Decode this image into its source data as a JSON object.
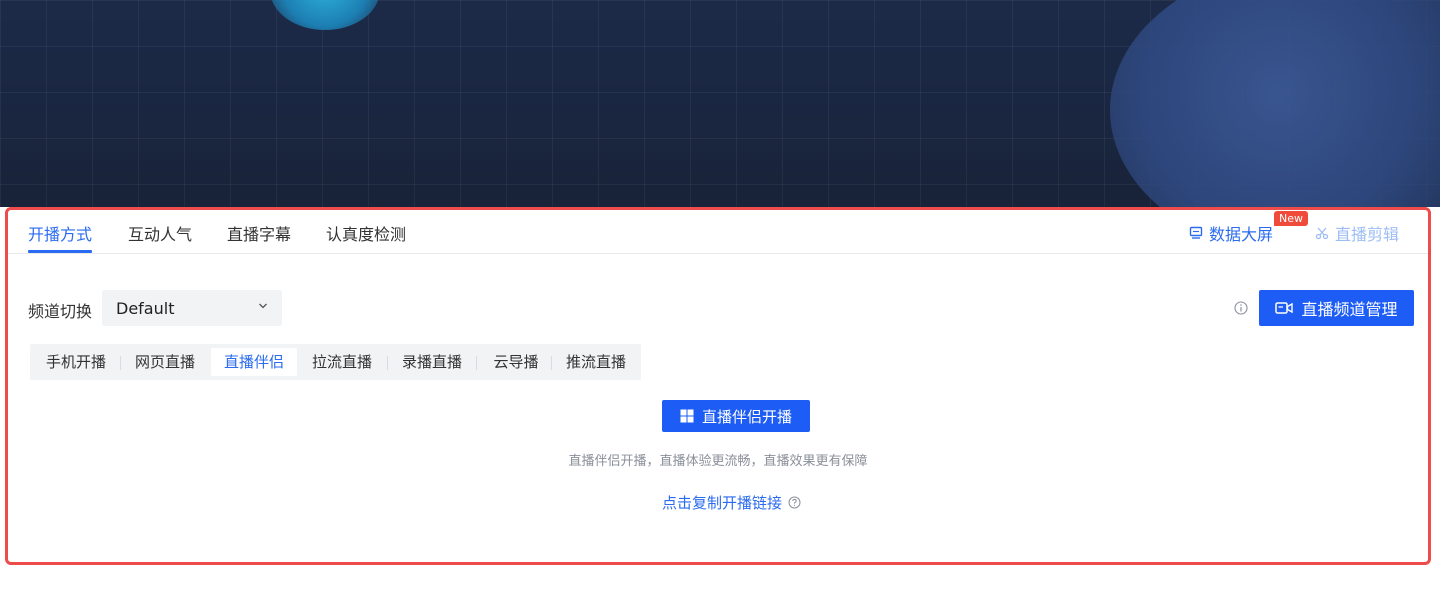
{
  "tabs": [
    {
      "label": "开播方式",
      "active": true
    },
    {
      "label": "互动人气",
      "active": false
    },
    {
      "label": "直播字幕",
      "active": false
    },
    {
      "label": "认真度检测",
      "active": false
    }
  ],
  "top_right": {
    "data_screen": {
      "label": "数据大屏",
      "icon": "monitor-icon",
      "badge": "New"
    },
    "live_edit": {
      "label": "直播剪辑",
      "icon": "scissors-icon",
      "disabled": true
    }
  },
  "channel": {
    "label": "频道切换",
    "selected": "Default"
  },
  "manage_button": {
    "label": "直播频道管理",
    "icon": "camera-icon"
  },
  "modes": [
    {
      "label": "手机开播",
      "active": false
    },
    {
      "label": "网页直播",
      "active": false
    },
    {
      "label": "直播伴侣",
      "active": true
    },
    {
      "label": "拉流直播",
      "active": false
    },
    {
      "label": "录播直播",
      "active": false
    },
    {
      "label": "云导播",
      "active": false
    },
    {
      "label": "推流直播",
      "active": false
    }
  ],
  "start_button": {
    "label": "直播伴侣开播",
    "icon": "windows-icon"
  },
  "hint": "直播伴侣开播，直播体验更流畅，直播效果更有保障",
  "copy_link": {
    "label": "点击复制开播链接",
    "icon": "help-circle-icon"
  },
  "colors": {
    "accent": "#1d5cf5",
    "highlight_border": "#ee4b4b",
    "badge": "#f04a3a"
  }
}
